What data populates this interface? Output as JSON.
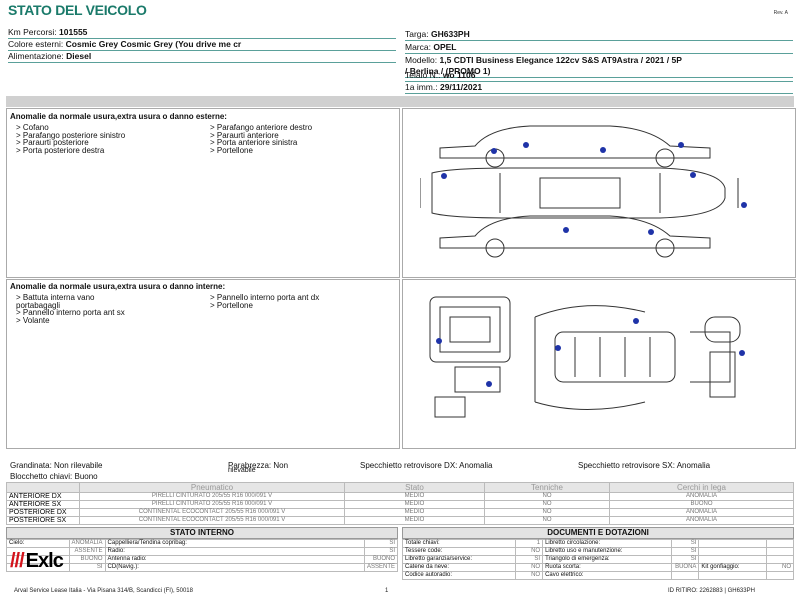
{
  "header": {
    "title": "STATO DEL VEICOLO",
    "rev": "Rev. A"
  },
  "vehicle_left": [
    {
      "label": "Km Percorsi:",
      "value": "101555"
    },
    {
      "label": "Colore esterni:",
      "value": "Cosmic Grey Cosmic Grey (You drive me cr"
    },
    {
      "label": "Alimentazione:",
      "value": "Diesel"
    }
  ],
  "vehicle_right": [
    {
      "label": "Targa:",
      "value": "GH633PH"
    },
    {
      "label": "Marca:",
      "value": "OPEL"
    },
    {
      "label": "Modello:",
      "value": "1,5 CDTI Business Elegance 122cv S&S AT9Astra / 2021 / 5P"
    },
    {
      "label": "",
      "value": "/ Berlina / (PROMO 1)"
    },
    {
      "label": "Telaio N.:",
      "value": "wo 1106"
    },
    {
      "label": "1a imm.:",
      "value": "29/11/2021"
    }
  ],
  "external": {
    "title": "Anomalie da normale usura,extra usura o danno esterne:",
    "col1": [
      "> Cofano",
      "> Parafango posteriore sinistro",
      "> Paraurti posteriore",
      "> Porta posteriore destra"
    ],
    "col2": [
      "> Parafango anteriore destro",
      "> Paraurti anteriore",
      "> Porta anteriore sinistra",
      "> Portellone"
    ]
  },
  "internal": {
    "title": "Anomalie da normale usura,extra usura o danno interne:",
    "col1": [
      "> Battuta interna vano",
      "portabagagli",
      "> Pannello interno porta ant sx",
      "> Volante"
    ],
    "col2": [
      "> Pannello interno porta ant dx",
      "> Portellone"
    ]
  },
  "status_line": {
    "grandinata": "Grandinata: Non rilevabile",
    "parabrezza": "Parabrezza: Non",
    "parabrezza2": "rilevabile",
    "dx": "Specchietto retrovisore DX: Anomalia",
    "sx": "Specchietto retrovisore SX: Anomalia",
    "blocchetto": "Blocchetto chiavi: Buono"
  },
  "tyres": {
    "headers": [
      "Pneumatico",
      "Stato",
      "Tenniche",
      "Cerchi in lega"
    ],
    "rows": [
      {
        "pos": "ANTERIORE DX",
        "tyre": "PIRELLI  CINTURATO  205/55 R16 000/091 V",
        "stato": "MEDIO",
        "tech": "NO",
        "rim": "ANOMALIA"
      },
      {
        "pos": "ANTERIORE SX",
        "tyre": "PIRELLI  CINTURATO  205/55 R16 000/091 V",
        "stato": "MEDIO",
        "tech": "NO",
        "rim": "BUONO"
      },
      {
        "pos": "POSTERIORE DX",
        "tyre": "CONTINENTAL ECOCONTACT  205/55 R16 000/091 V",
        "stato": "MEDIO",
        "tech": "NO",
        "rim": "ANOMALIA"
      },
      {
        "pos": "POSTERIORE SX",
        "tyre": "CONTINENTAL ECOCONTACT  205/55 R16 000/091 V",
        "stato": "MEDIO",
        "tech": "NO",
        "rim": "ANOMALIA"
      }
    ]
  },
  "stato_interno": {
    "title": "STATO INTERNO",
    "rows": [
      [
        "Cielo:",
        "ANOMALIA",
        "Cappelliera/Tendina copribag:",
        "SI"
      ],
      [
        "",
        "ASSENTE",
        "Radio:",
        "SI"
      ],
      [
        "",
        "BUONO",
        "Antenna radio:",
        "BUONO"
      ],
      [
        "",
        "SI",
        "CD(Navig.):",
        "ASSENTE"
      ]
    ]
  },
  "documenti": {
    "title": "DOCUMENTI E DOTAZIONI",
    "rows": [
      [
        "Totale chiavi:",
        "1",
        "Libretto circolazione:",
        "SI",
        "",
        ""
      ],
      [
        "Tessere code:",
        "NO",
        "Libretto uso e manutenzione:",
        "SI",
        "",
        ""
      ],
      [
        "Libretto garanzia/service:",
        "SI",
        "Triangolo di emergenza:",
        "SI",
        "",
        ""
      ],
      [
        "Catene da neve:",
        "NO",
        "Ruota scorta:",
        "BUONA",
        "Kit gonfiaggio:",
        "NO"
      ],
      [
        "Codice autoradio:",
        "NO",
        "Cavo elettrico:",
        "",
        "",
        ""
      ]
    ]
  },
  "logo": {
    "bars": "///",
    "text": "Exlc"
  },
  "footer": {
    "address": "Arval Service Lease Italia - Via Pisana 314/B, Scandicci (FI), 50018",
    "page": "1",
    "id": "ID RITIRO: 2262883 | GH633PH"
  }
}
